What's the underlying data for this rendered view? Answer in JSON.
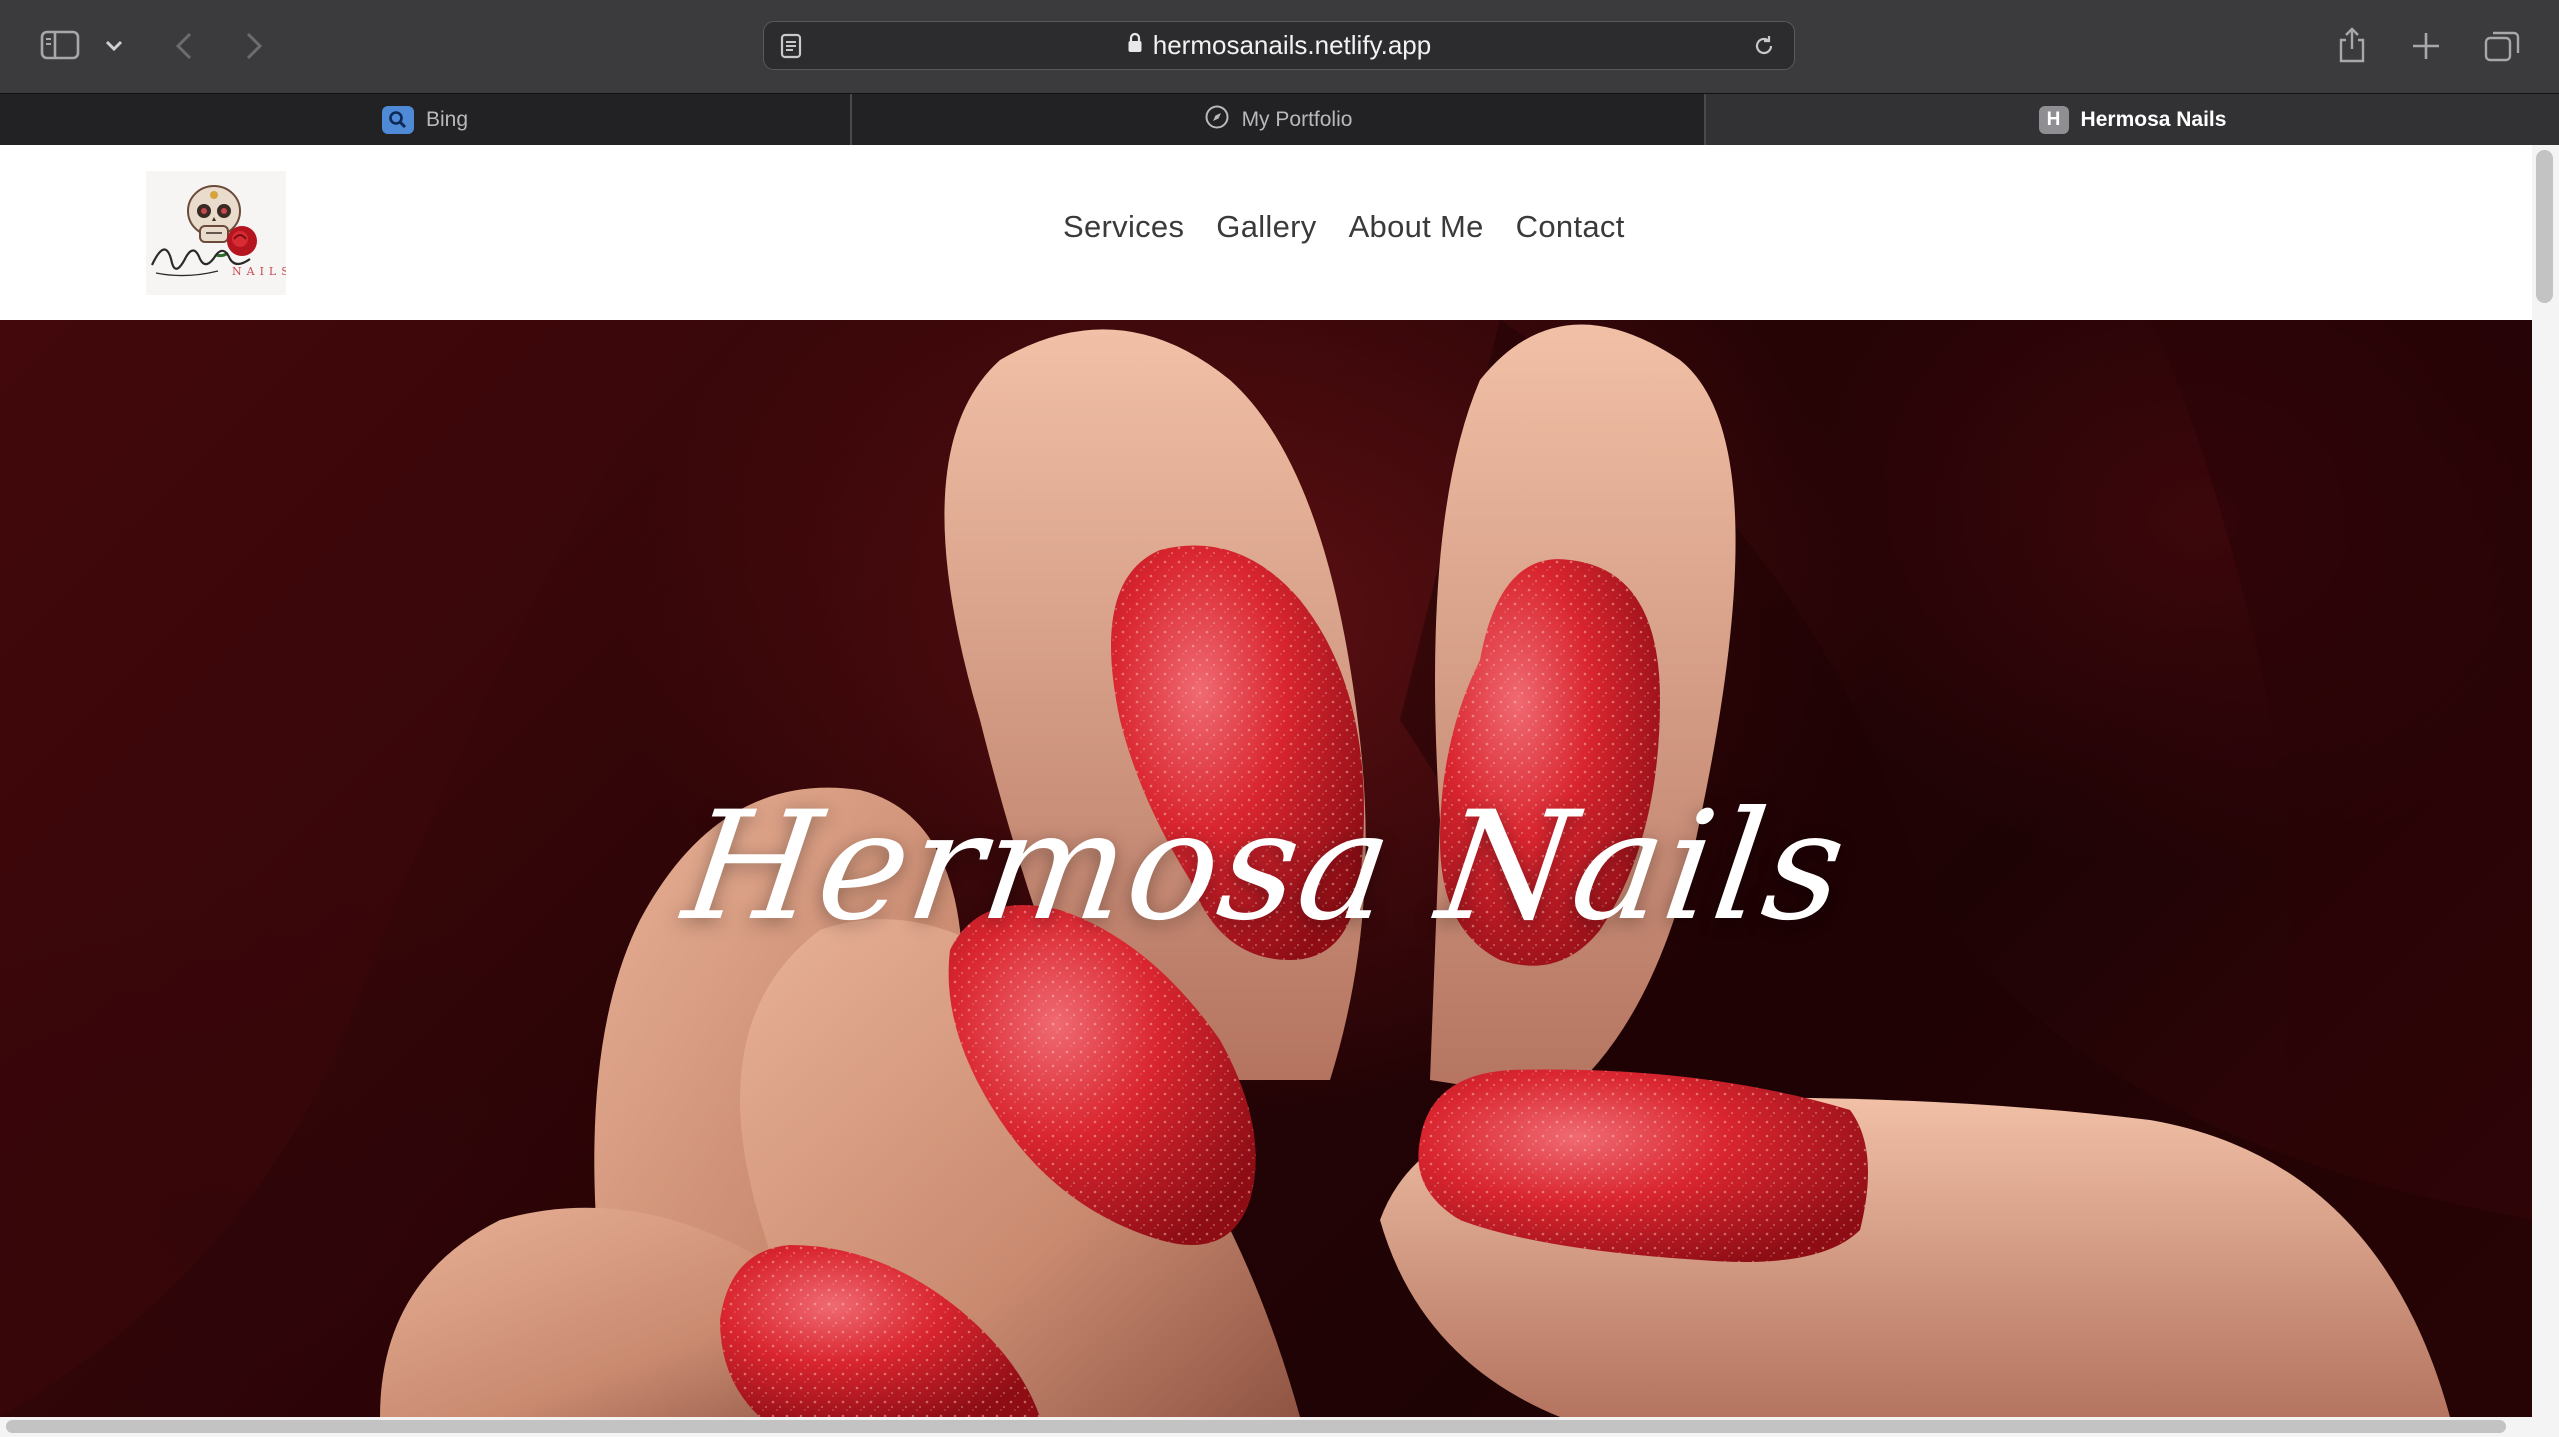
{
  "browser": {
    "url": "hermosanails.netlify.app",
    "tabs": [
      {
        "title": "Bing",
        "favicon": "search-icon",
        "favicon_color": "#4f8ad6"
      },
      {
        "title": "My Portfolio",
        "favicon": "compass-icon",
        "favicon_color": "#b9b9bd"
      },
      {
        "title": "Hermosa Nails",
        "favicon": "H",
        "favicon_color": "#8e8e93",
        "active": true
      }
    ]
  },
  "site": {
    "nav": [
      "Services",
      "Gallery",
      "About Me",
      "Contact"
    ],
    "hero_title": "Hermosa Nails",
    "accent_color": "#d4232c"
  }
}
